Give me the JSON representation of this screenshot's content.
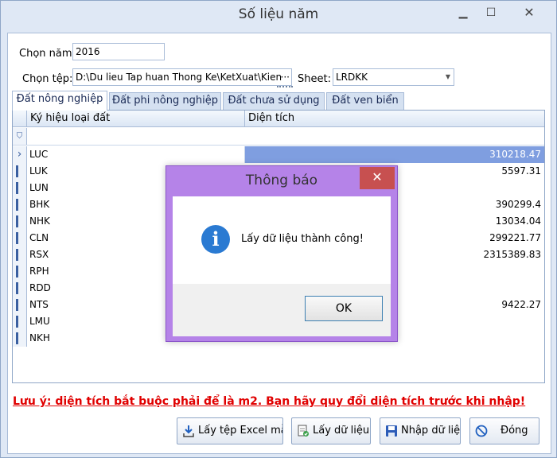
{
  "window": {
    "title": "Số liệu năm",
    "min_icon": "minimize-icon",
    "max_icon": "maximize-icon",
    "close_icon": "close-icon"
  },
  "form": {
    "year_label": "Chọn năm:",
    "year_value": "2016",
    "file_label": "Chọn tệp:",
    "file_value": "D:\\Du lieu Tap huan Thong Ke\\KetXuat\\Kien",
    "file_browse": "···",
    "sheet_label": "Sheet:",
    "sheet_value": "LRDKK"
  },
  "tabs": [
    {
      "label": "Đất nông nghiệp",
      "active": true
    },
    {
      "label": "Đất phi nông nghiệp",
      "active": false
    },
    {
      "label": "Đất chưa sử dụng",
      "active": false
    },
    {
      "label": "Đất ven biển",
      "active": false
    }
  ],
  "grid": {
    "columns": [
      "Ký hiệu loại đất",
      "Diện tích"
    ],
    "rows": [
      {
        "code": "LUC",
        "area": "310218.47"
      },
      {
        "code": "LUK",
        "area": "5597.31"
      },
      {
        "code": "LUN",
        "area": ""
      },
      {
        "code": "BHK",
        "area": "390299.4"
      },
      {
        "code": "NHK",
        "area": "13034.04"
      },
      {
        "code": "CLN",
        "area": "299221.77"
      },
      {
        "code": "RSX",
        "area": "2315389.83"
      },
      {
        "code": "RPH",
        "area": ""
      },
      {
        "code": "RDD",
        "area": ""
      },
      {
        "code": "NTS",
        "area": "9422.27"
      },
      {
        "code": "LMU",
        "area": ""
      },
      {
        "code": "NKH",
        "area": ""
      }
    ],
    "selected_index": 0,
    "selected_color": "#7f9ee0"
  },
  "note": "Lưu ý: diện tích bắt buộc phải để là m2. Bạn hãy quy đổi diện tích trước khi nhập!",
  "buttons": {
    "template": "Lấy tệp Excel mẫu",
    "load": "Lấy dữ liệu",
    "import": "Nhập dữ liệu",
    "close": "Đóng"
  },
  "dialog": {
    "title": "Thông báo",
    "message": "Lấy dữ liệu thành công!",
    "ok": "OK",
    "icon_glyph": "i",
    "accent": "#b583e8"
  }
}
